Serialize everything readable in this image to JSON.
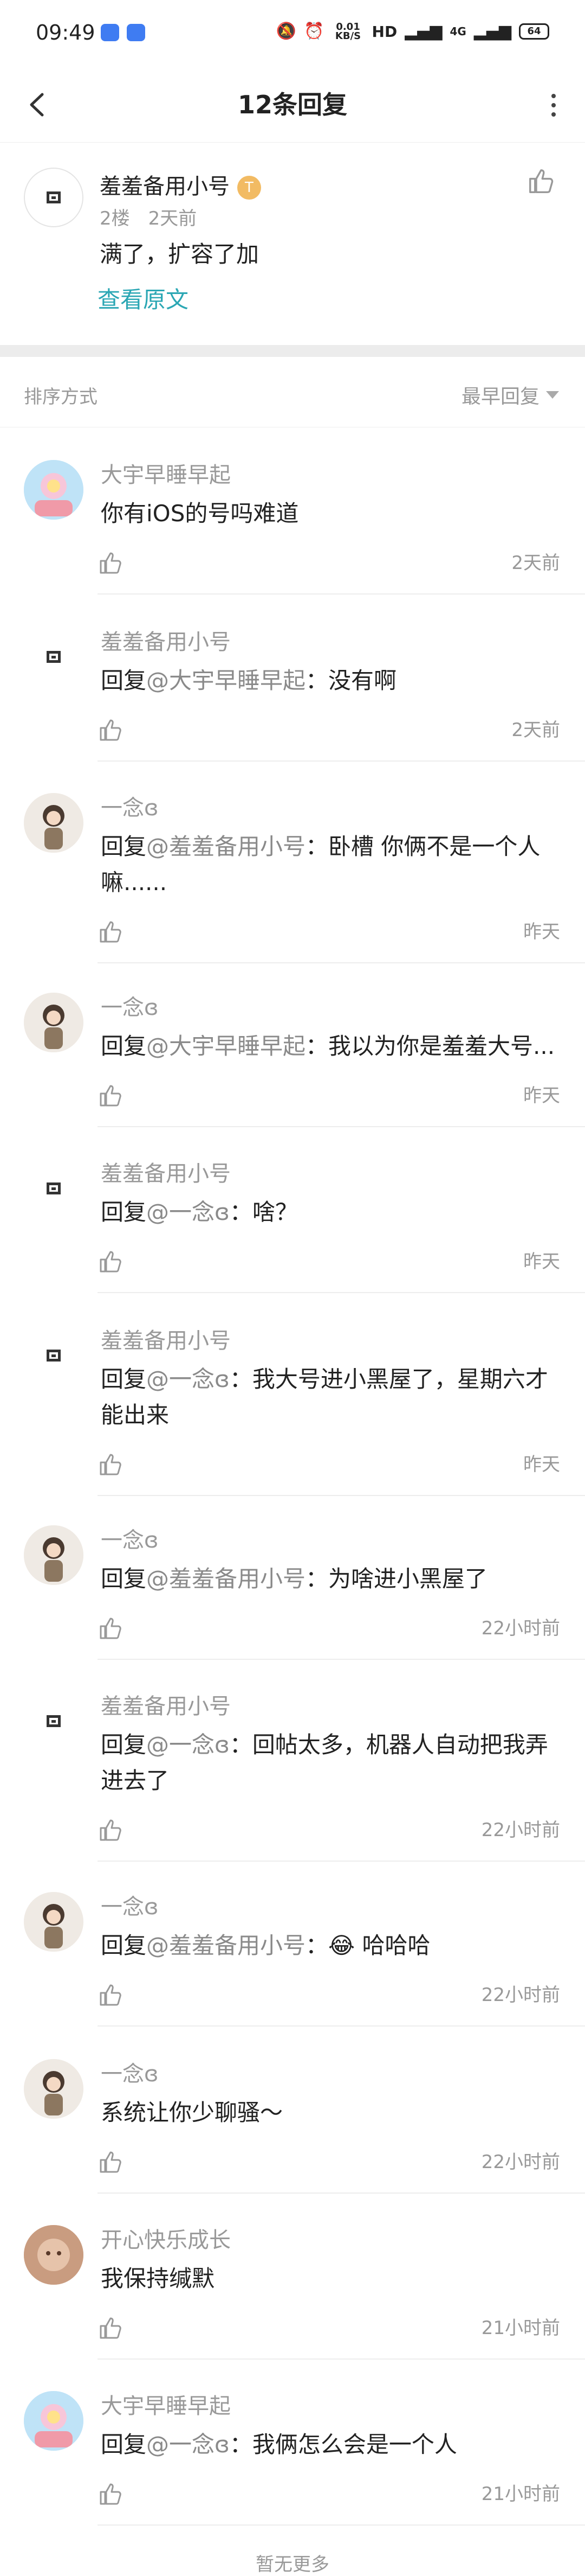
{
  "status_bar": {
    "time": "09:49",
    "network_speed": "0.01 KB/S",
    "signal_labels": [
      "HD",
      "4G",
      "4G"
    ],
    "battery": "64"
  },
  "nav": {
    "title": "12条回复"
  },
  "post": {
    "author": "羞羞备用小号",
    "medal": "T",
    "floor": "2楼",
    "time": "2天前",
    "text": "满了，扩容了加",
    "view_original": "查看原文"
  },
  "sort": {
    "label": "排序方式",
    "value": "最早回复"
  },
  "replies": [
    {
      "author": "大宇早睡早起",
      "avatar": "colorful",
      "reply_prefix": "",
      "mention": "",
      "text": "你有iOS的号吗难道",
      "time": "2天前"
    },
    {
      "author": "羞羞备用小号",
      "avatar": "mini",
      "reply_prefix": "回复",
      "mention": "@大宇早睡早起",
      "text": "：没有啊",
      "time": "2天前"
    },
    {
      "author": "一念ɞ",
      "avatar": "doll",
      "reply_prefix": "回复",
      "mention": "@羞羞备用小号",
      "text": "：卧槽 你俩不是一个人嘛......",
      "time": "昨天"
    },
    {
      "author": "一念ɞ",
      "avatar": "doll",
      "reply_prefix": "回复",
      "mention": "@大宇早睡早起",
      "text": "：我以为你是羞羞大号...",
      "time": "昨天"
    },
    {
      "author": "羞羞备用小号",
      "avatar": "mini",
      "reply_prefix": "回复",
      "mention": "@一念ɞ",
      "text": "：啥？",
      "time": "昨天"
    },
    {
      "author": "羞羞备用小号",
      "avatar": "mini",
      "reply_prefix": "回复",
      "mention": "@一念ɞ",
      "text": "：我大号进小黑屋了，星期六才能出来",
      "time": "昨天"
    },
    {
      "author": "一念ɞ",
      "avatar": "doll",
      "reply_prefix": "回复",
      "mention": "@羞羞备用小号",
      "text": "：为啥进小黑屋了",
      "time": "22小时前"
    },
    {
      "author": "羞羞备用小号",
      "avatar": "mini",
      "reply_prefix": "回复",
      "mention": "@一念ɞ",
      "text": "：回帖太多，机器人自动把我弄进去了",
      "time": "22小时前"
    },
    {
      "author": "一念ɞ",
      "avatar": "doll",
      "reply_prefix": "回复",
      "mention": "@羞羞备用小号",
      "text": "：😂 哈哈哈",
      "time": "22小时前"
    },
    {
      "author": "一念ɞ",
      "avatar": "doll",
      "reply_prefix": "",
      "mention": "",
      "text": "系统让你少聊骚～",
      "time": "22小时前"
    },
    {
      "author": "开心快乐成长",
      "avatar": "photo",
      "reply_prefix": "",
      "mention": "",
      "text": "我保持缄默",
      "time": "21小时前"
    },
    {
      "author": "大宇早睡早起",
      "avatar": "colorful",
      "reply_prefix": "回复",
      "mention": "@一念ɞ",
      "text": "：我俩怎么会是一个人",
      "time": "21小时前"
    }
  ],
  "load_more": "暂无更多"
}
